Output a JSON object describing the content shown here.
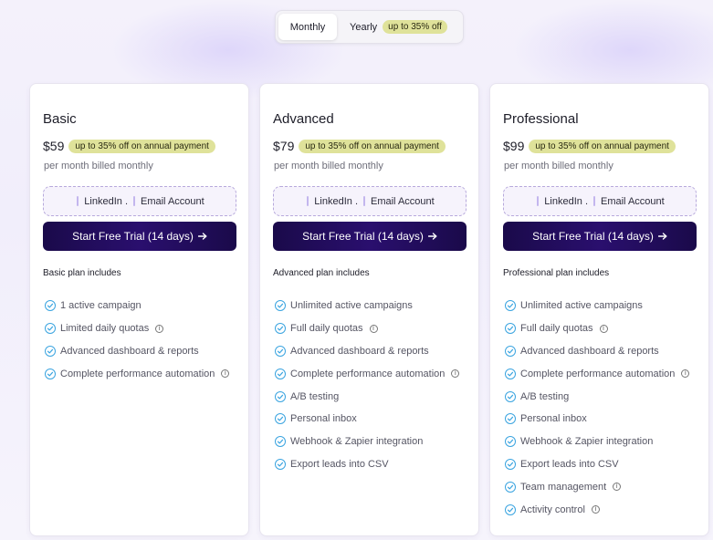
{
  "toggle": {
    "monthly_label": "Monthly",
    "yearly_label": "Yearly",
    "yearly_discount": "up to 35% off"
  },
  "plans": [
    {
      "name": "Basic",
      "price": "$59",
      "price_badge": "up to 35% off on annual payment",
      "billing": "per month billed monthly",
      "accounts": {
        "linkedin": "LinkedIn .",
        "email": "Email Account"
      },
      "cta": "Start Free Trial (14 days)",
      "includes_title": "Basic plan includes",
      "features": [
        {
          "label": "1 active campaign",
          "info": false
        },
        {
          "label": "Limited daily quotas",
          "info": true
        },
        {
          "label": "Advanced dashboard & reports",
          "info": false
        },
        {
          "label": "Complete performance automation",
          "info": true
        }
      ]
    },
    {
      "name": "Advanced",
      "price": "$79",
      "price_badge": "up to 35% off on annual payment",
      "billing": "per month billed monthly",
      "accounts": {
        "linkedin": "LinkedIn .",
        "email": "Email Account"
      },
      "cta": "Start Free Trial (14 days)",
      "includes_title": "Advanced plan includes",
      "features": [
        {
          "label": "Unlimited active campaigns",
          "info": false
        },
        {
          "label": "Full daily quotas",
          "info": true
        },
        {
          "label": "Advanced dashboard & reports",
          "info": false
        },
        {
          "label": "Complete performance automation",
          "info": true
        },
        {
          "label": "A/B testing",
          "info": false
        },
        {
          "label": "Personal inbox",
          "info": false
        },
        {
          "label": "Webhook & Zapier integration",
          "info": false
        },
        {
          "label": "Export leads into CSV",
          "info": false
        }
      ]
    },
    {
      "name": "Professional",
      "price": "$99",
      "price_badge": "up to 35% off on annual payment",
      "billing": "per month billed monthly",
      "accounts": {
        "linkedin": "LinkedIn .",
        "email": "Email Account"
      },
      "cta": "Start Free Trial (14 days)",
      "includes_title": "Professional plan includes",
      "features": [
        {
          "label": "Unlimited active campaigns",
          "info": false
        },
        {
          "label": "Full daily quotas",
          "info": true
        },
        {
          "label": "Advanced dashboard & reports",
          "info": false
        },
        {
          "label": "Complete performance automation",
          "info": true
        },
        {
          "label": "A/B testing",
          "info": false
        },
        {
          "label": "Personal inbox",
          "info": false
        },
        {
          "label": "Webhook & Zapier integration",
          "info": false
        },
        {
          "label": "Export leads into CSV",
          "info": false
        },
        {
          "label": "Team management",
          "info": true
        },
        {
          "label": "Activity control",
          "info": true
        }
      ]
    }
  ],
  "icons": {
    "check": "check-circle-icon",
    "info": "info-icon",
    "arrow": "arrow-right-icon",
    "account_marker": "bar-icon"
  },
  "colors": {
    "accent_cta": "#1a0a4a",
    "discount_pill": "#dfe29a",
    "check": "#3aa4e0",
    "dashed_border": "#b7a9dc"
  }
}
